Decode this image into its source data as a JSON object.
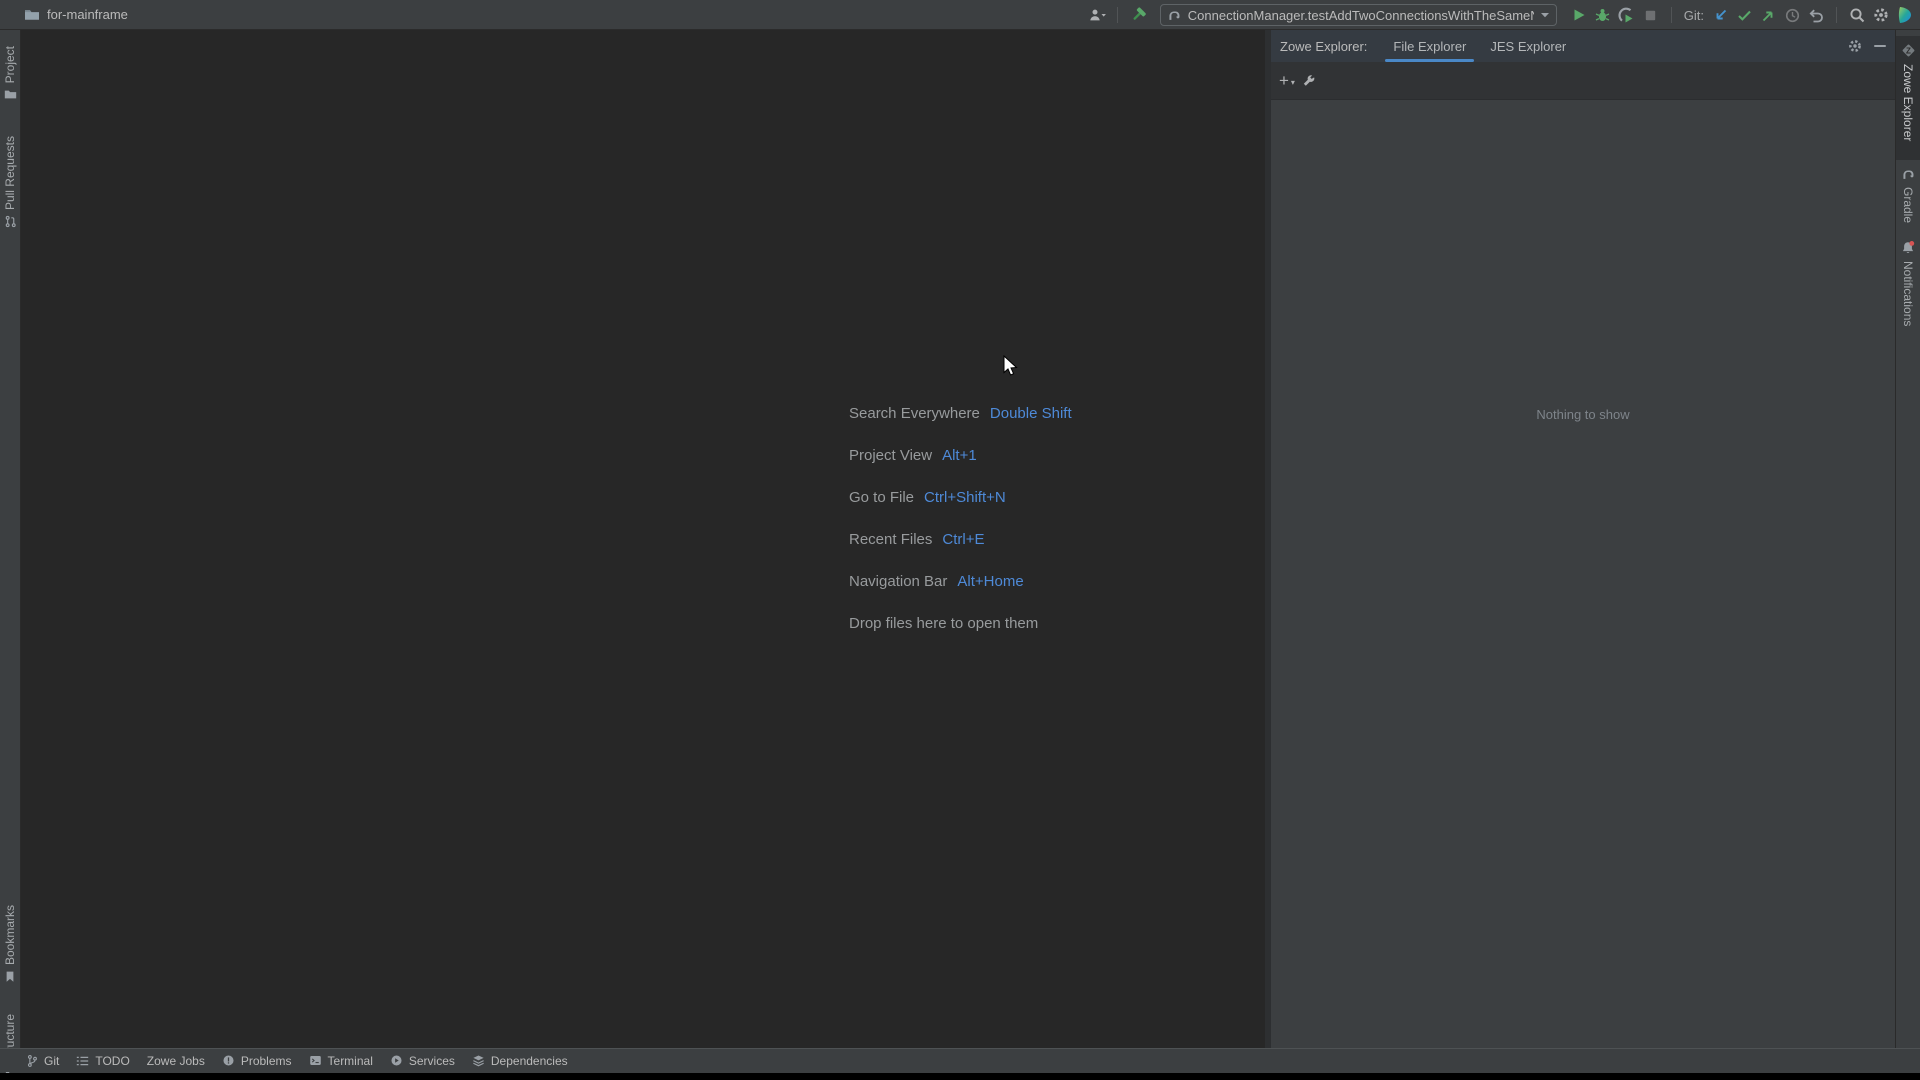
{
  "colors": {
    "panel_bg": "#3c3f41",
    "editor_bg": "#272727",
    "accent_tab_underline": "#4a88c7",
    "shortcut_key_blue": "#4e8ad8",
    "run_green": "#59a869",
    "git_update_blue": "#4593ce",
    "notification_dot_red": "#e05555"
  },
  "title_bar": {
    "project_name": "for-mainframe",
    "run_config": "ConnectionManager.testAddTwoConnectionsWithTheSameName",
    "git_label": "Git:"
  },
  "left_bar": {
    "top_items": [
      {
        "label": "Project",
        "icon": "folder-icon"
      },
      {
        "label": "Pull Requests",
        "icon": "pull-request-icon"
      }
    ],
    "bottom_items": [
      {
        "label": "Bookmarks",
        "icon": "bookmark-icon"
      },
      {
        "label": "Structure",
        "icon": "structure-icon"
      }
    ]
  },
  "right_bar": {
    "items": [
      {
        "label": "Zowe Explorer",
        "icon": "zowe-icon",
        "active": true
      },
      {
        "label": "Gradle",
        "icon": "gradle-icon",
        "active": false
      },
      {
        "label": "Notifications",
        "icon": "bell-icon",
        "active": false
      }
    ]
  },
  "tool_window": {
    "title": "Zowe Explorer:",
    "tabs": [
      {
        "label": "File Explorer",
        "selected": true
      },
      {
        "label": "JES Explorer",
        "selected": false
      }
    ],
    "add_glyph": "+",
    "empty_text": "Nothing to show"
  },
  "editor": {
    "shortcuts": [
      {
        "label": "Search Everywhere",
        "keys": "Double Shift"
      },
      {
        "label": "Project View",
        "keys": "Alt+1"
      },
      {
        "label": "Go to File",
        "keys": "Ctrl+Shift+N"
      },
      {
        "label": "Recent Files",
        "keys": "Ctrl+E"
      },
      {
        "label": "Navigation Bar",
        "keys": "Alt+Home"
      },
      {
        "label": "Drop files here to open them",
        "keys": ""
      }
    ]
  },
  "status_bar": {
    "items": [
      {
        "label": "Git",
        "icon": "git-branch-icon"
      },
      {
        "label": "TODO",
        "icon": "todo-icon"
      },
      {
        "label": "Zowe Jobs",
        "icon": ""
      },
      {
        "label": "Problems",
        "icon": "problems-icon"
      },
      {
        "label": "Terminal",
        "icon": "terminal-icon"
      },
      {
        "label": "Services",
        "icon": "services-icon"
      },
      {
        "label": "Dependencies",
        "icon": "dependencies-icon"
      }
    ]
  }
}
